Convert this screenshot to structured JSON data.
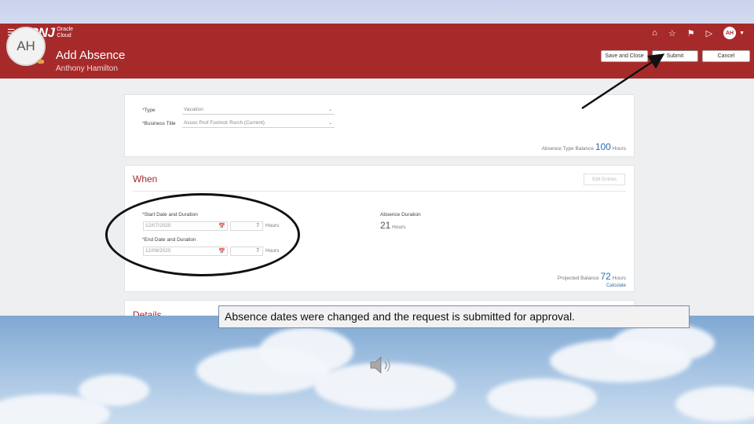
{
  "topbar": {
    "menu_icon": "hamburger-icon",
    "logo": "TCNJ",
    "logo_sub": "Oracle Cloud",
    "icons": [
      "home-icon",
      "star-icon",
      "flag-icon",
      "play-icon"
    ],
    "user_initials": "AH"
  },
  "header": {
    "avatar_initials": "AH",
    "title": "Add Absence",
    "subtitle": "Anthony Hamilton",
    "save_close_label": "Save and Close",
    "submit_label": "Submit",
    "cancel_label": "Cancel"
  },
  "type_card": {
    "type_label": "Type",
    "type_value": "Vacation",
    "business_title_label": "Business Title",
    "business_title_value": "Assoc Prof Foclnstr Rsrch (Current)",
    "balance_label": "Absence Type Balance",
    "balance_value": "100",
    "balance_unit": "Hours"
  },
  "when_card": {
    "title": "When",
    "edit_entries_label": "Edit Entries",
    "start_label": "Start Date and Duration",
    "start_date": "12/07/2020",
    "start_hours": "7",
    "end_label": "End Date and Duration",
    "end_date": "12/09/2020",
    "end_hours": "7",
    "hours_unit": "Hours",
    "absence_duration_label": "Absence Duration",
    "absence_duration_value": "21",
    "projected_label": "Projected Balance",
    "projected_value": "72",
    "calculate_label": "Calculate"
  },
  "details_card": {
    "title": "Details"
  },
  "caption": "Absence dates were changed and the request is submitted for approval.",
  "colors": {
    "brand_red": "#a72a2b",
    "link_blue": "#2a6fb0"
  }
}
